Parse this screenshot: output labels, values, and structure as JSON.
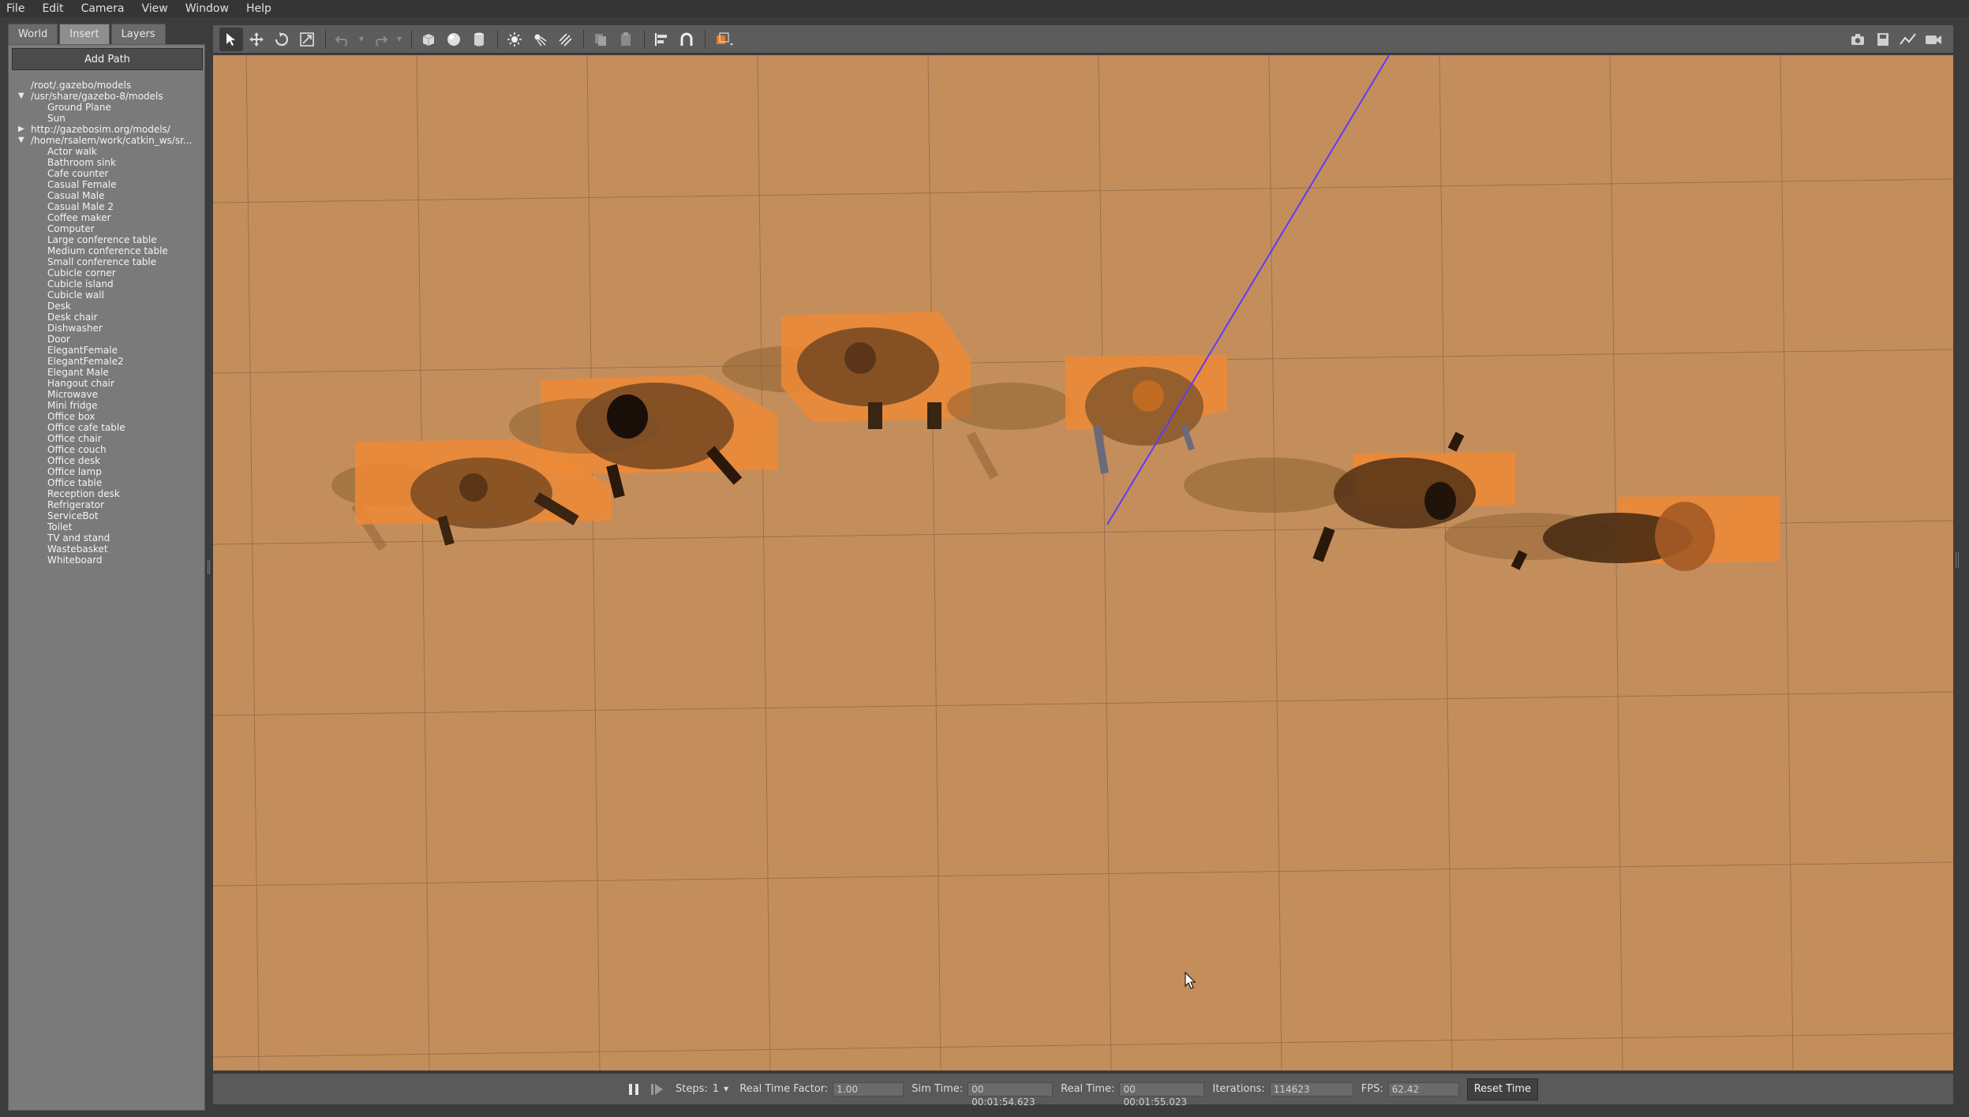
{
  "menu": {
    "items": [
      "File",
      "Edit",
      "Camera",
      "View",
      "Window",
      "Help"
    ]
  },
  "left_panel": {
    "tabs": [
      "World",
      "Insert",
      "Layers"
    ],
    "active_tab": "Insert",
    "add_path_label": "Add Path",
    "tree": {
      "roots": [
        "/root/.gazebo/models",
        "/usr/share/gazebo-8/models",
        "http://gazebosim.org/models/",
        "/home/rsalem/work/catkin_ws/sr..."
      ],
      "usr_items": [
        "Ground Plane",
        "Sun"
      ],
      "home_items": [
        "Actor walk",
        "Bathroom sink",
        "Cafe counter",
        "Casual Female",
        "Casual Male",
        "Casual Male 2",
        "Coffee maker",
        "Computer",
        "Large conference table",
        "Medium conference table",
        "Small conference table",
        "Cubicle corner",
        "Cubicle island",
        "Cubicle wall",
        "Desk",
        "Desk chair",
        "Dishwasher",
        "Door",
        "ElegantFemale",
        "ElegantFemale2",
        "Elegant Male",
        "Hangout chair",
        "Microwave",
        "Mini fridge",
        "Office box",
        "Office cafe table",
        "Office chair",
        "Office couch",
        "Office desk",
        "Office lamp",
        "Office table",
        "Reception desk",
        "Refrigerator",
        "ServiceBot",
        "Toilet",
        "TV and stand",
        "Wastebasket",
        "Whiteboard"
      ]
    }
  },
  "toolbar": {
    "tools": [
      "select-icon",
      "translate-icon",
      "rotate-icon",
      "scale-icon",
      "undo-icon",
      "redo-icon",
      "box-icon",
      "sphere-icon",
      "cylinder-icon",
      "point-light-icon",
      "spot-light-icon",
      "directional-light-icon",
      "copy-icon",
      "paste-icon",
      "align-icon",
      "snap-icon",
      "view-angle-icon"
    ],
    "right_tools": [
      "screenshot-icon",
      "log-icon",
      "plot-icon",
      "video-icon"
    ]
  },
  "status": {
    "steps_label": "Steps:",
    "steps_value": "1",
    "rtf_label": "Real Time Factor:",
    "rtf_value": "1.00",
    "sim_time_label": "Sim Time:",
    "sim_time_value": "00 00:01:54.623",
    "real_time_label": "Real Time:",
    "real_time_value": "00 00:01:55.023",
    "iterations_label": "Iterations:",
    "iterations_value": "114623",
    "fps_label": "FPS:",
    "fps_value": "62.42",
    "reset_label": "Reset Time"
  },
  "colors": {
    "ground": "#c48e5c",
    "grid_line": "#8f6a47",
    "actor_box": "#ef8a35",
    "axis_line": "#5b3cff"
  }
}
